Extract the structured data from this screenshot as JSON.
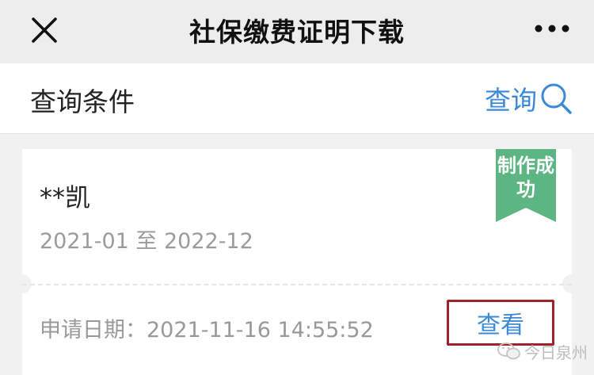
{
  "nav": {
    "title": "社保缴费证明下载"
  },
  "query_bar": {
    "label": "查询条件",
    "query_label": "查询"
  },
  "record": {
    "name": "**凯",
    "period": "2021-01 至 2022-12",
    "status": "制作成功",
    "apply_date_label": "申请日期：",
    "apply_date": "2021-11-16 14:55:52",
    "view_label": "查看"
  },
  "watermark": {
    "text": "今日泉州"
  },
  "colors": {
    "accent": "#3b8ad9",
    "status_green": "#5db583",
    "highlight_red": "#a0222b"
  }
}
